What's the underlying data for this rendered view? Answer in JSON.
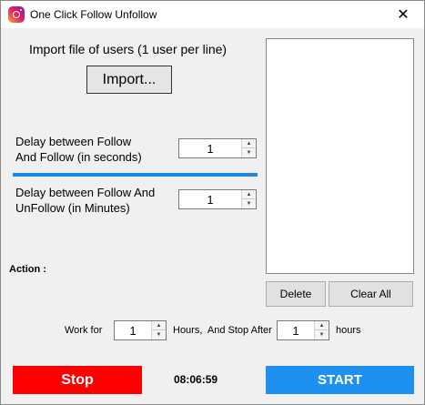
{
  "window": {
    "title": "One Click Follow Unfollow",
    "close_glyph": "✕"
  },
  "import": {
    "label": "Import file of users (1 user per line)",
    "button": "Import..."
  },
  "delay_follow": {
    "label_line1": "Delay between Follow",
    "label_line2": "And Follow (in seconds)",
    "value": "1"
  },
  "delay_unfollow": {
    "label_line1": "Delay between Follow And",
    "label_line2": "UnFollow (in Minutes)",
    "value": "1"
  },
  "action": {
    "label": "Action :"
  },
  "list_buttons": {
    "delete": "Delete",
    "clear_all": "Clear All"
  },
  "schedule": {
    "work_for": "Work for",
    "work_hours_value": "1",
    "hours_and_stop": "Hours,  And Stop After",
    "stop_hours_value": "1",
    "hours": "hours"
  },
  "controls": {
    "stop": "Stop",
    "timer": "08:06:59",
    "start": "START"
  },
  "colors": {
    "stop": "#ff0000",
    "start": "#1e90f0",
    "separator": "#1e88e5"
  },
  "icons": {
    "app": "instagram-icon",
    "close": "close-icon",
    "spin_up": "arrow-up-icon",
    "spin_down": "arrow-down-icon"
  }
}
